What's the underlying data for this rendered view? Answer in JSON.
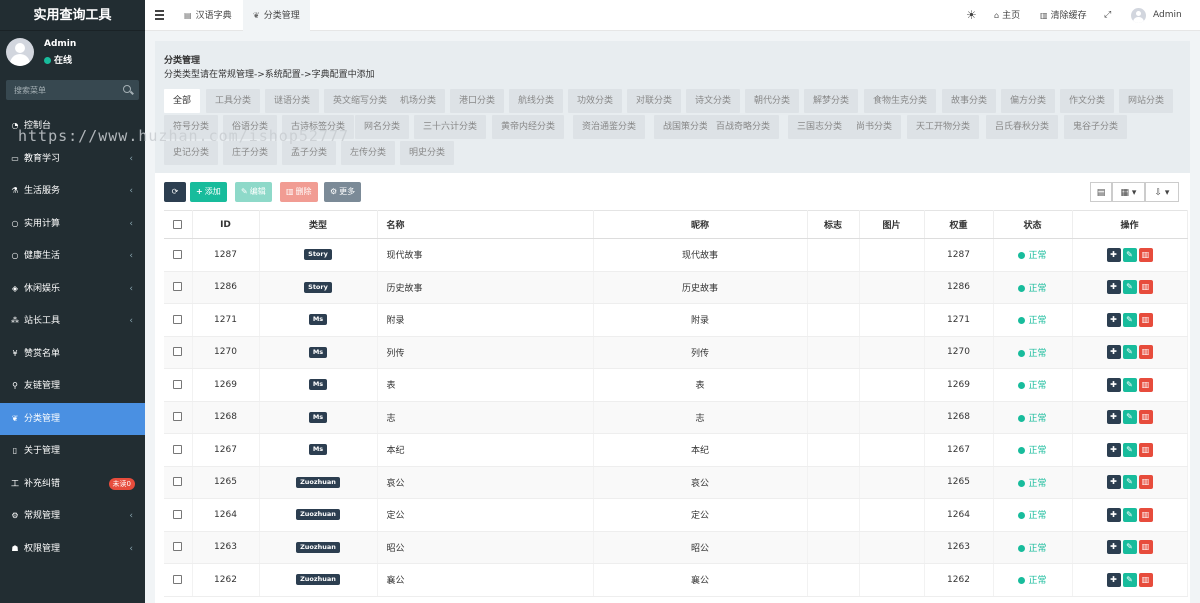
{
  "app": {
    "brand": "实用查询工具",
    "user_name": "Admin",
    "user_status": "在线",
    "search_placeholder": "搜索菜单",
    "watermark": "https://www.huzhan.com/ishop52777"
  },
  "sidebar": {
    "items": [
      {
        "label": "控制台",
        "icon": "dashboard-icon",
        "glyph": "◔",
        "arrow": false,
        "active": false
      },
      {
        "label": "教育学习",
        "icon": "monitor-icon",
        "glyph": "▭",
        "arrow": true,
        "active": false
      },
      {
        "label": "生活服务",
        "icon": "flask-icon",
        "glyph": "⚗",
        "arrow": true,
        "active": false
      },
      {
        "label": "实用计算",
        "icon": "circle-icon",
        "glyph": "○",
        "arrow": true,
        "active": false
      },
      {
        "label": "健康生活",
        "icon": "circle-icon",
        "glyph": "○",
        "arrow": true,
        "active": false
      },
      {
        "label": "休闲娱乐",
        "icon": "gamepad-icon",
        "glyph": "◈",
        "arrow": true,
        "active": false
      },
      {
        "label": "站长工具",
        "icon": "sitemap-icon",
        "glyph": "⁂",
        "arrow": true,
        "active": false
      },
      {
        "label": "赞赏名单",
        "icon": "yen-icon",
        "glyph": "¥",
        "arrow": false,
        "active": false
      },
      {
        "label": "友链管理",
        "icon": "link-icon",
        "glyph": "⚲",
        "arrow": false,
        "active": false
      },
      {
        "label": "分类管理",
        "icon": "leaf-icon",
        "glyph": "❦",
        "arrow": false,
        "active": true
      },
      {
        "label": "关于管理",
        "icon": "file-icon",
        "glyph": "▯",
        "arrow": false,
        "active": false
      },
      {
        "label": "补充纠错",
        "icon": "text-icon",
        "glyph": "工",
        "arrow": false,
        "active": false,
        "badge": "未读0"
      },
      {
        "label": "常规管理",
        "icon": "cogs-icon",
        "glyph": "⚙",
        "arrow": true,
        "active": false
      },
      {
        "label": "权限管理",
        "icon": "group-icon",
        "glyph": "☗",
        "arrow": true,
        "active": false
      }
    ]
  },
  "topbar": {
    "tab1": "汉语字典",
    "tab2": "分类管理",
    "home": "主页",
    "clear_cache": "清除缓存",
    "user": "Admin"
  },
  "panel": {
    "title": "分类管理",
    "subtitle": "分类类型请在常规管理->系统配置->字典配置中添加",
    "categories": [
      "全部",
      "工具分类",
      "谜语分类",
      "英文缩写分类",
      "机场分类",
      "港口分类",
      "航线分类",
      "功效分类",
      "对联分类",
      "诗文分类",
      "朝代分类",
      "解梦分类",
      "食物生克分类",
      "故事分类",
      "偏方分类",
      "作文分类",
      "网站分类",
      "符号分类",
      "俗语分类",
      "古诗标签分类",
      "网名分类",
      "三十六计分类",
      "黄帝内经分类",
      "资治通鉴分类",
      "战国策分类",
      "百战奇略分类",
      "三国志分类",
      "尚书分类",
      "天工开物分类",
      "吕氏春秋分类",
      "鬼谷子分类",
      "史记分类",
      "庄子分类",
      "孟子分类",
      "左传分类",
      "明史分类"
    ]
  },
  "toolbar": {
    "refresh": "⟳",
    "add": "添加",
    "edit": "编辑",
    "delete": "删除",
    "more": "更多"
  },
  "table": {
    "headers": [
      "ID",
      "类型",
      "名称",
      "昵称",
      "标志",
      "图片",
      "权重",
      "状态",
      "操作"
    ],
    "rows": [
      {
        "id": "1287",
        "type": "Story",
        "name": "现代故事",
        "nickname": "现代故事",
        "weight": "1287",
        "status": "正常"
      },
      {
        "id": "1286",
        "type": "Story",
        "name": "历史故事",
        "nickname": "历史故事",
        "weight": "1286",
        "status": "正常"
      },
      {
        "id": "1271",
        "type": "Ms",
        "name": "附录",
        "nickname": "附录",
        "weight": "1271",
        "status": "正常"
      },
      {
        "id": "1270",
        "type": "Ms",
        "name": "列传",
        "nickname": "列传",
        "weight": "1270",
        "status": "正常"
      },
      {
        "id": "1269",
        "type": "Ms",
        "name": "表",
        "nickname": "表",
        "weight": "1269",
        "status": "正常"
      },
      {
        "id": "1268",
        "type": "Ms",
        "name": "志",
        "nickname": "志",
        "weight": "1268",
        "status": "正常"
      },
      {
        "id": "1267",
        "type": "Ms",
        "name": "本纪",
        "nickname": "本纪",
        "weight": "1267",
        "status": "正常"
      },
      {
        "id": "1265",
        "type": "Zuozhuan",
        "name": "哀公",
        "nickname": "哀公",
        "weight": "1265",
        "status": "正常"
      },
      {
        "id": "1264",
        "type": "Zuozhuan",
        "name": "定公",
        "nickname": "定公",
        "weight": "1264",
        "status": "正常"
      },
      {
        "id": "1263",
        "type": "Zuozhuan",
        "name": "昭公",
        "nickname": "昭公",
        "weight": "1263",
        "status": "正常"
      },
      {
        "id": "1262",
        "type": "Zuozhuan",
        "name": "襄公",
        "nickname": "襄公",
        "weight": "1262",
        "status": "正常"
      }
    ]
  },
  "colors": {
    "sidebar_bg": "#222d32",
    "active": "#4a90e2",
    "success": "#18bc9c",
    "danger": "#e74c3c",
    "dark": "#2c3e50"
  }
}
